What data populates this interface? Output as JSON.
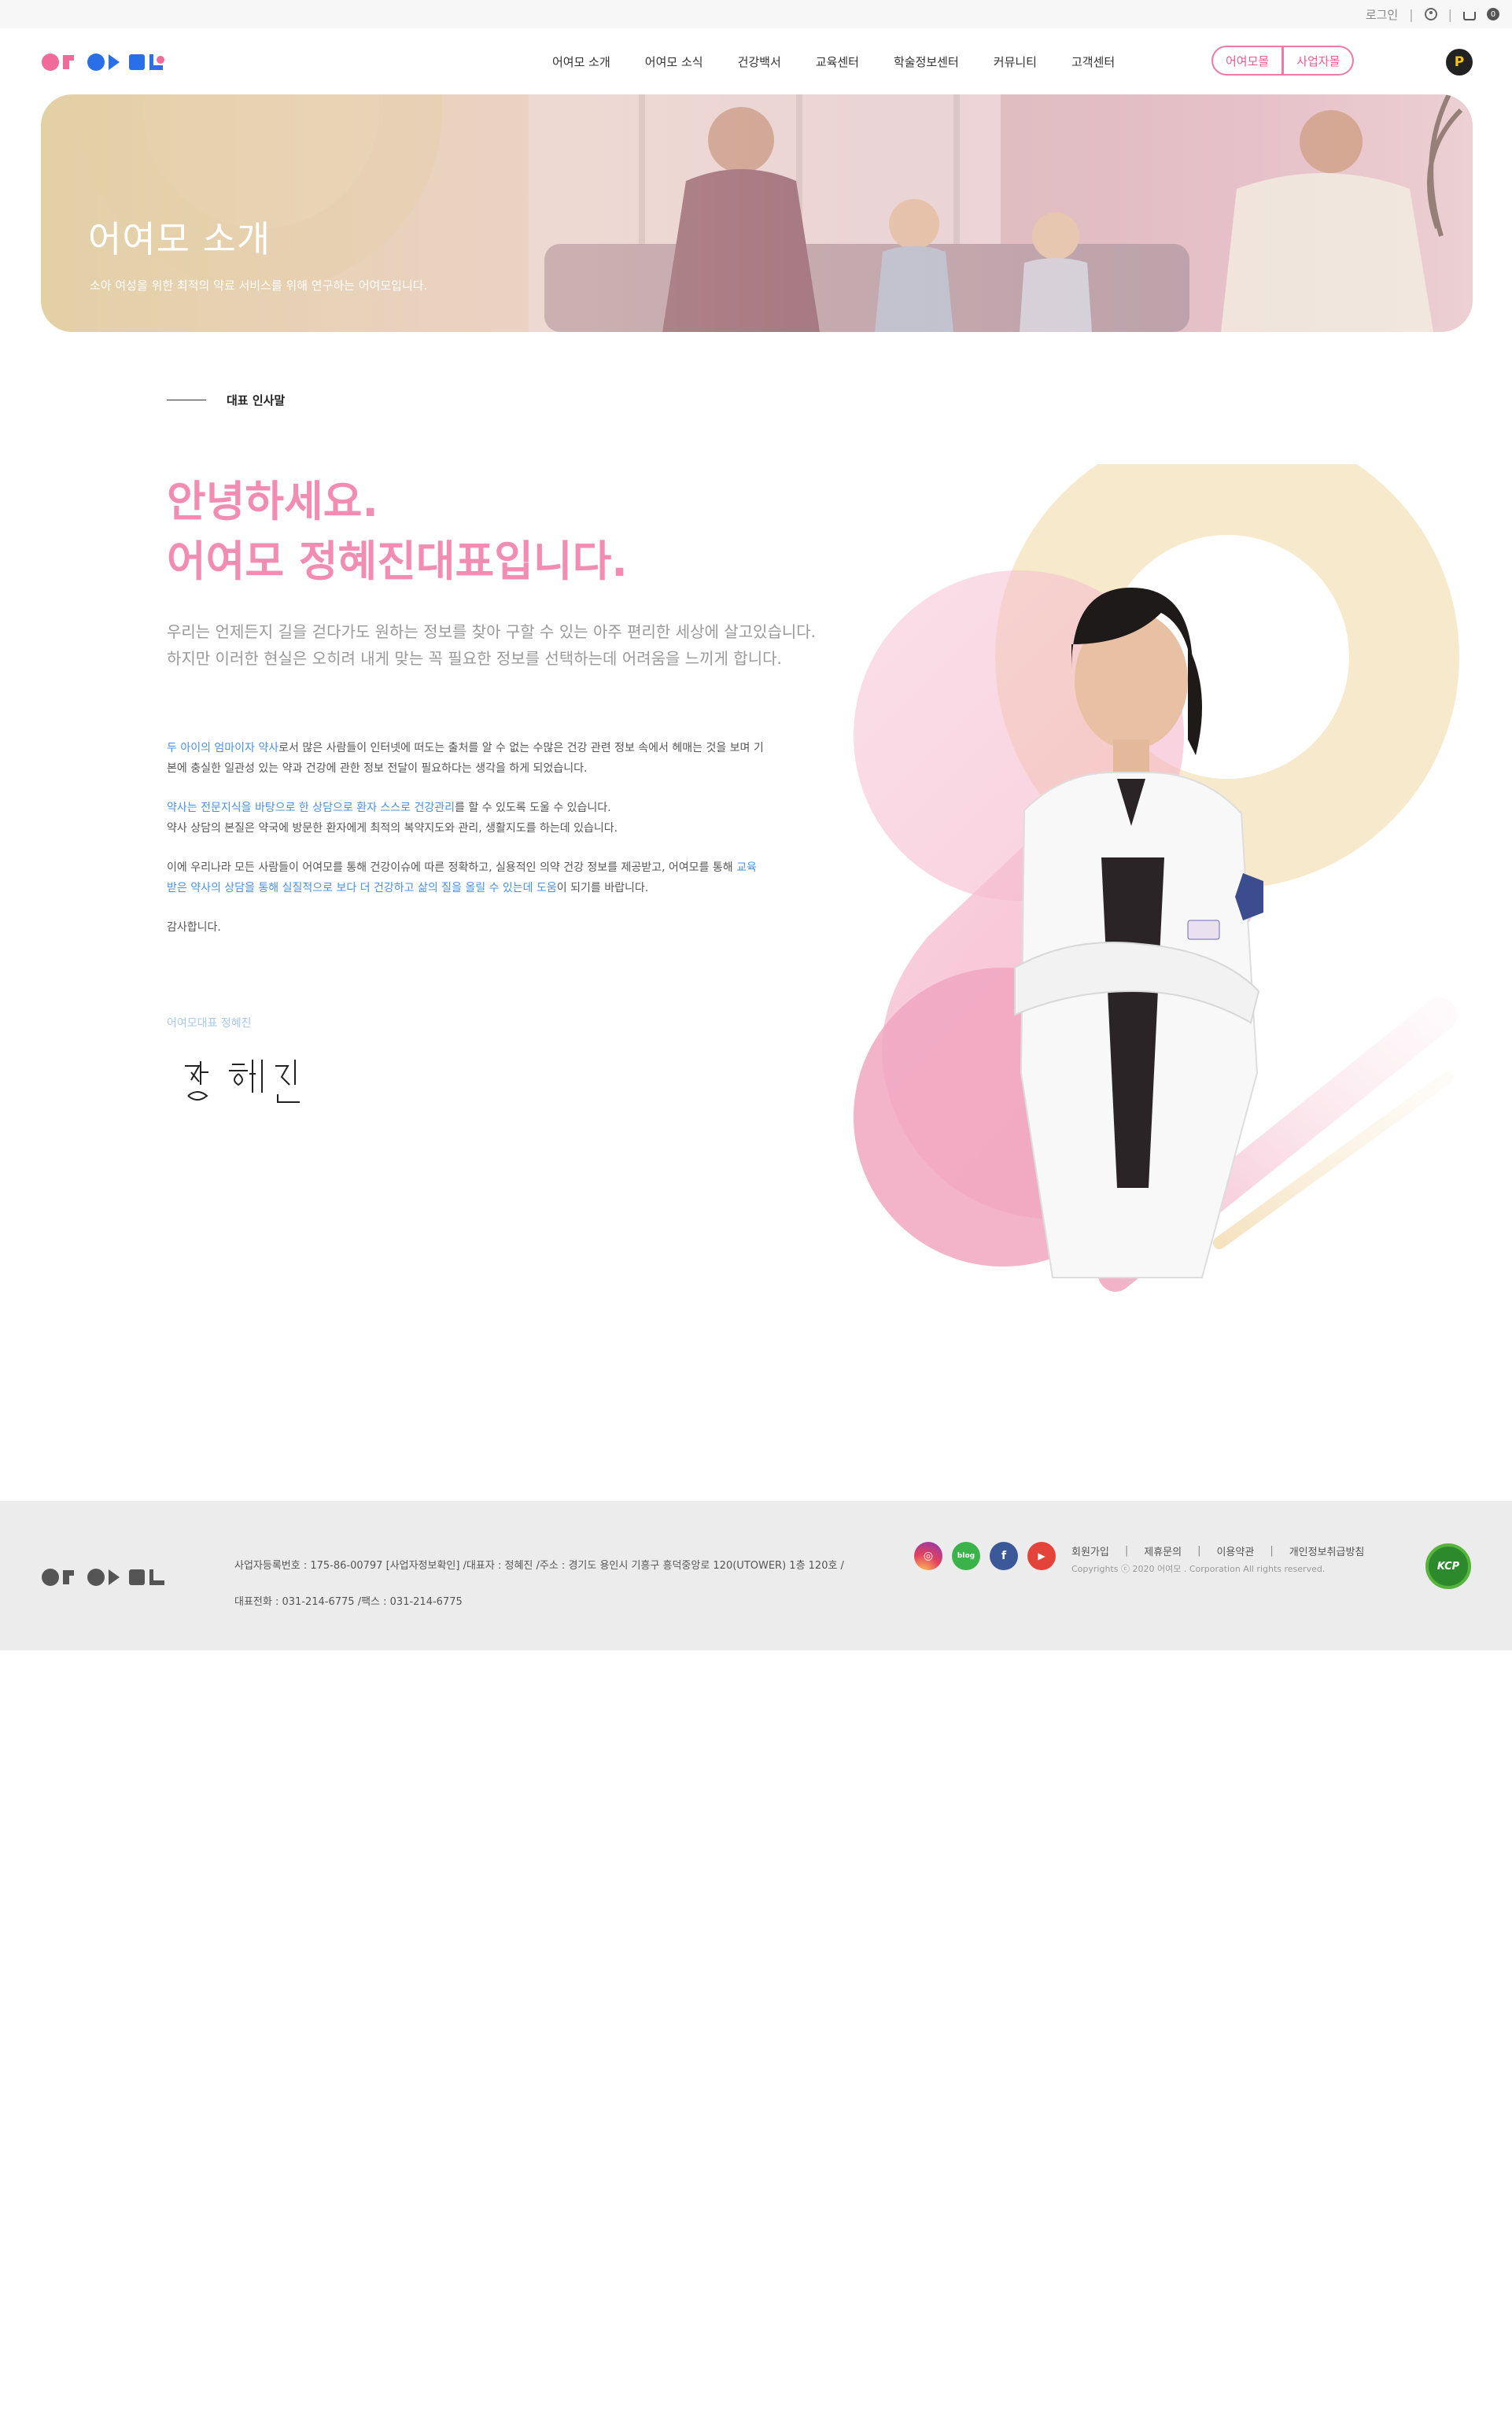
{
  "topbar": {
    "login": "로그인",
    "cart_count": "0",
    "user_icon": "user-icon",
    "cart_icon": "cart-icon"
  },
  "header": {
    "logo_icon": "oyeomo-logo",
    "nav": [
      "어여모 소개",
      "어여모 소식",
      "건강백서",
      "교육센터",
      "학술정보센터",
      "커뮤니티",
      "고객센터"
    ],
    "pill_left": "어여모몰",
    "pill_right": "사업자몰",
    "point_badge": "P"
  },
  "hero": {
    "title": "어여모 소개",
    "subtitle": "소아 여성을 위한 최적의 약료 서비스를 위해 연구하는 어여모입니다."
  },
  "section": {
    "label": "대표 인사말",
    "greeting_line1": "안녕하세요.",
    "greeting_line2": "어여모 정혜진대표입니다.",
    "intro_line1": "우리는 언제든지 길을 걷다가도 원하는 정보를 찾아 구할 수 있는 아주 편리한 세상에 살고있습니다.",
    "intro_line2": "하지만 이러한 현실은 오히려 내게 맞는 꼭 필요한 정보를 선택하는데 어려움을 느끼게 합니다.",
    "p1_hl": "두 아이의 엄마이자 약사",
    "p1_rest": "로서 많은 사람들이 인터넷에 떠도는 출처를 알 수 없는 수많은 건강 관련 정보 속에서 헤매는 것을 보며 기본에 충실한 일관성 있는 약과 건강에 관한 정보 전달이 필요하다는 생각을 하게 되었습니다.",
    "p2_hl": "약사는 전문지식을 바탕으로 한 상담으로 환자 스스로 건강관리",
    "p2_rest": "를 할 수 있도록 도울 수 있습니다.",
    "p2_line2": "약사 상담의 본질은 약국에 방문한 환자에게 최적의 복약지도와 관리, 생활지도를 하는데 있습니다.",
    "p3_a": "이에 우리나라 모든 사람들이 어여모를 통해 건강이슈에 따른 정확하고, 실용적인 의약 건강 정보를 제공받고, 어여모를 통해 ",
    "p3_hl": "교육받은 약사의 상담을 통해 실질적으로 보다 더 건강하고 삶의 질을 올릴 수 있는데 도움",
    "p3_rest": "이 되기를 바랍니다.",
    "p4": "감사합니다.",
    "sign_caption": "어여모대표 정혜진",
    "signature_text": "정혜진"
  },
  "footer": {
    "logo_icon": "oyeomo-logo",
    "info_line1": "사업자등록번호 : 175-86-00797 [사업자정보확인] /대표자 : 정혜진 /주소 : 경기도 용인시 기흥구 흥덕중앙로 120(UTOWER) 1층 120호 /",
    "info_line2": "대표전화 : 031-214-6775 /팩스 : 031-214-6775",
    "sns": [
      "instagram-icon",
      "blog-icon",
      "facebook-icon",
      "youtube-icon"
    ],
    "menu": [
      "회원가입",
      "제휴문의",
      "이용약관",
      "개인정보취급방침"
    ],
    "copyright": "Copyrights ⓒ 2020 어여모 . Corporation All rights reserved.",
    "kcp": "KCP"
  },
  "colors": {
    "accent_pink": "#f38cb2",
    "highlight_blue": "#4a90e2",
    "footer_bg": "#ececec"
  }
}
